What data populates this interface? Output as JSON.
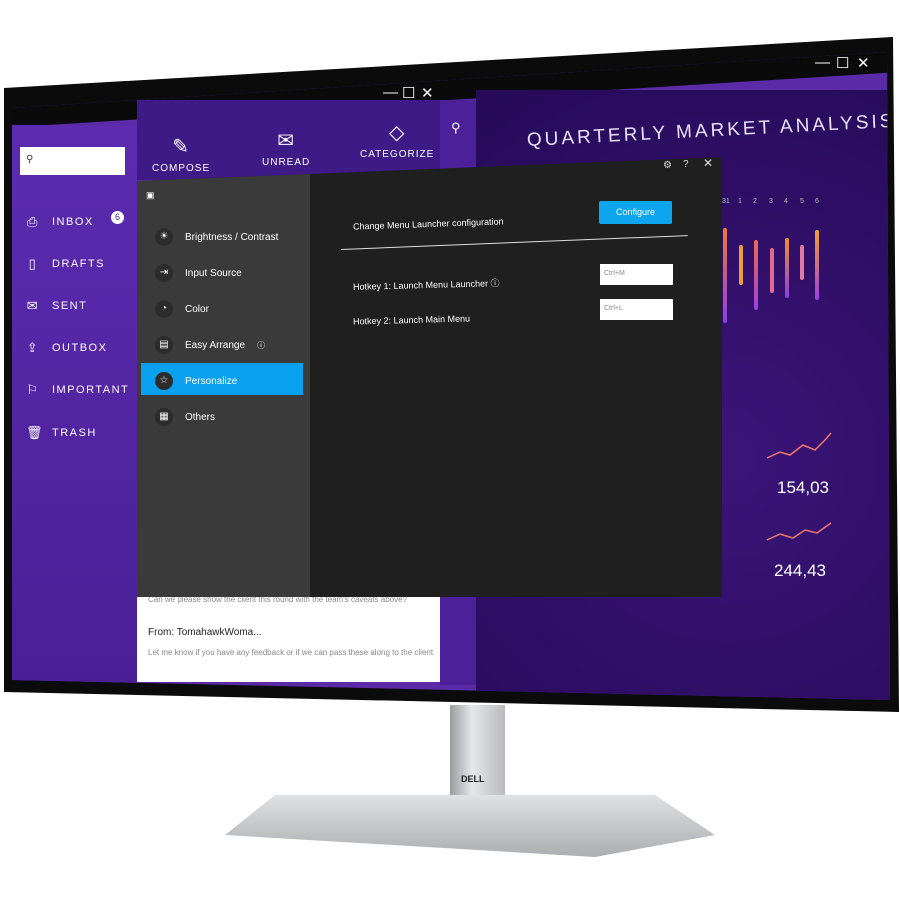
{
  "window_controls": [
    "—",
    "☐",
    "✕"
  ],
  "sidebar": {
    "search_placeholder": "",
    "items": [
      {
        "label": "INBOX",
        "icon": "inbox-icon",
        "badge": "6"
      },
      {
        "label": "DRAFTS",
        "icon": "document-icon"
      },
      {
        "label": "SENT",
        "icon": "envelope-icon"
      },
      {
        "label": "OUTBOX",
        "icon": "outbox-icon"
      },
      {
        "label": "IMPORTANT",
        "icon": "flag-icon"
      },
      {
        "label": "TRASH",
        "icon": "trash-icon"
      }
    ]
  },
  "toolbar": [
    {
      "label": "COMPOSE",
      "icon": "pencil-icon"
    },
    {
      "label": "UNREAD",
      "icon": "envelope-icon"
    },
    {
      "label": "CATEGORIZE",
      "icon": "tag-icon"
    }
  ],
  "dashboard": {
    "title": "QUARTERLY MARKET ANALYSIS",
    "axis": [
      "31",
      "1",
      "2",
      "3",
      "4",
      "5",
      "6"
    ],
    "values": [
      "154,03",
      "244,43"
    ]
  },
  "email": {
    "preview1": "Can we please show the client this round with the team's caveats above?",
    "from": "From: TomahawkWoma...",
    "preview2": "Let me know if you have any feedback or if we can pass these along to the client"
  },
  "dialog": {
    "menu": [
      {
        "label": "Brightness / Contrast",
        "icon": "sun-icon"
      },
      {
        "label": "Input Source",
        "icon": "input-icon"
      },
      {
        "label": "Color",
        "icon": "palette-icon"
      },
      {
        "label": "Easy Arrange",
        "icon": "layout-icon",
        "info": true
      },
      {
        "label": "Personalize",
        "icon": "star-icon",
        "selected": true
      },
      {
        "label": "Others",
        "icon": "others-icon"
      }
    ],
    "launcher_label": "Change Menu Launcher configuration",
    "configure": "Configure",
    "hotkey1_label": "Hotkey 1: Launch Menu Launcher",
    "hotkey1_value": "Ctrl+M",
    "hotkey2_label": "Hotkey 2: Launch Main Menu",
    "hotkey2_value": "Ctrl+L"
  },
  "brand": "DELL",
  "colors": {
    "accent": "#09a0ef",
    "sidebar": "#5c2bb0",
    "dialog": "#1f1f1f"
  }
}
